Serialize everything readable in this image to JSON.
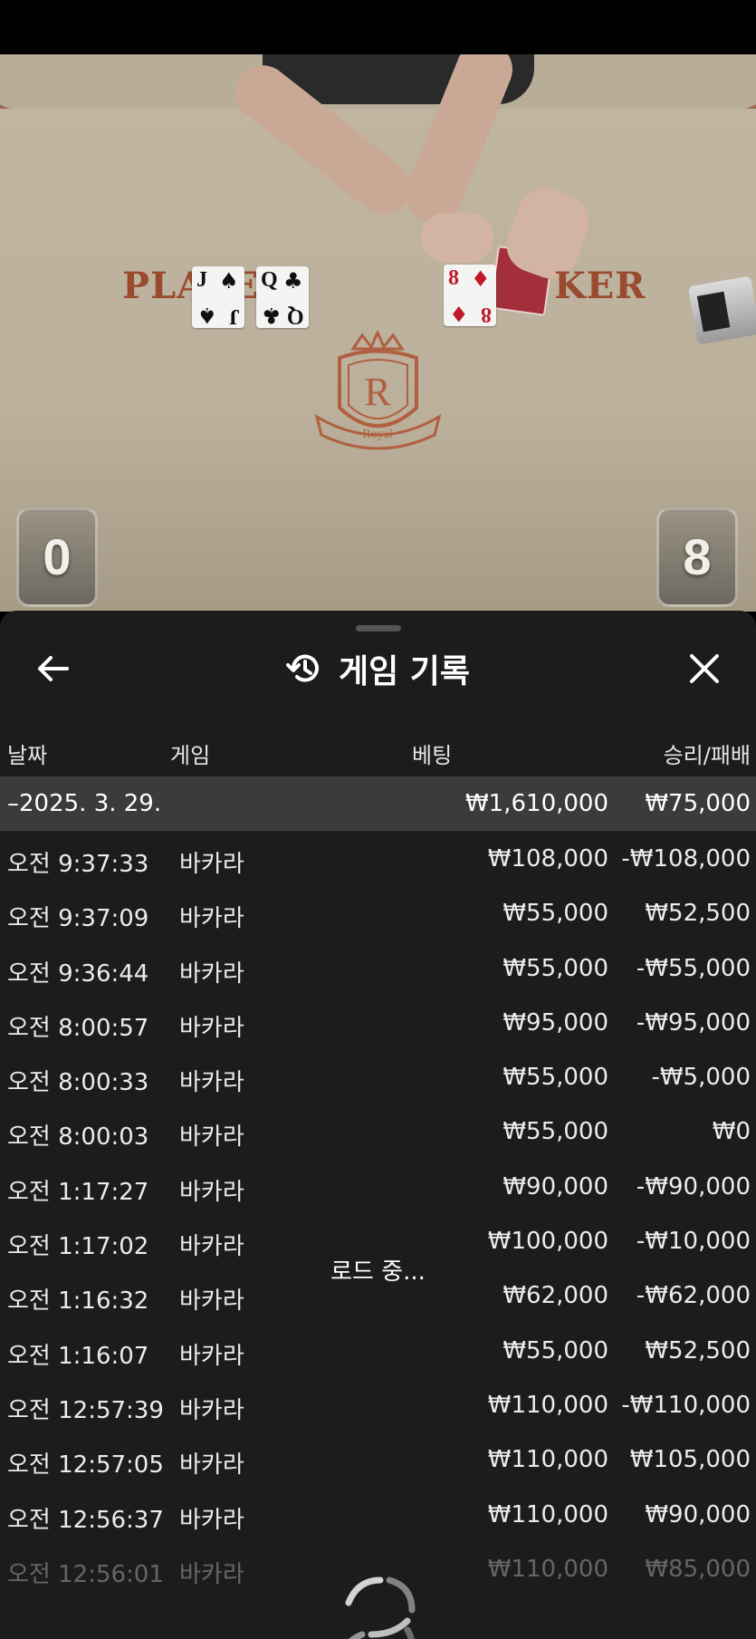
{
  "video": {
    "player_label": "PLAYER",
    "banker_label": "KER",
    "logo_letter": "R",
    "logo_text": "Royal",
    "player_score": "0",
    "banker_score": "8",
    "player_cards": [
      {
        "rank": "J",
        "suit": "♠",
        "color": "black"
      },
      {
        "rank": "Q",
        "suit": "♣",
        "color": "black"
      }
    ],
    "banker_cards": [
      {
        "rank": "8",
        "suit": "♦",
        "color": "red"
      }
    ]
  },
  "panel": {
    "title": "게임 기록",
    "back_icon": "arrow-left-icon",
    "close_icon": "close-icon",
    "title_icon": "history-icon",
    "columns": {
      "date": "날짜",
      "game": "게임",
      "bet": "베팅",
      "result": "승리/패배"
    },
    "date_group": {
      "date": "–2025. 3. 29.",
      "total_bet": "₩1,610,000",
      "total_result": "₩75,000"
    },
    "rows": [
      {
        "time": "오전 9:37:33",
        "game": "바카라",
        "bet": "₩108,000",
        "result": "-₩108,000"
      },
      {
        "time": "오전 9:37:09",
        "game": "바카라",
        "bet": "₩55,000",
        "result": "₩52,500"
      },
      {
        "time": "오전 9:36:44",
        "game": "바카라",
        "bet": "₩55,000",
        "result": "-₩55,000"
      },
      {
        "time": "오전 8:00:57",
        "game": "바카라",
        "bet": "₩95,000",
        "result": "-₩95,000"
      },
      {
        "time": "오전 8:00:33",
        "game": "바카라",
        "bet": "₩55,000",
        "result": "-₩5,000"
      },
      {
        "time": "오전 8:00:03",
        "game": "바카라",
        "bet": "₩55,000",
        "result": "₩0"
      },
      {
        "time": "오전 1:17:27",
        "game": "바카라",
        "bet": "₩90,000",
        "result": "-₩90,000"
      },
      {
        "time": "오전 1:17:02",
        "game": "바카라",
        "bet": "₩100,000",
        "result": "-₩10,000"
      },
      {
        "time": "오전 1:16:32",
        "game": "바카라",
        "bet": "₩62,000",
        "result": "-₩62,000"
      },
      {
        "time": "오전 1:16:07",
        "game": "바카라",
        "bet": "₩55,000",
        "result": "₩52,500"
      },
      {
        "time": "오전 12:57:39",
        "game": "바카라",
        "bet": "₩110,000",
        "result": "-₩110,000"
      },
      {
        "time": "오전 12:57:05",
        "game": "바카라",
        "bet": "₩110,000",
        "result": "₩105,000"
      },
      {
        "time": "오전 12:56:37",
        "game": "바카라",
        "bet": "₩110,000",
        "result": "₩90,000"
      },
      {
        "time": "오전 12:56:01",
        "game": "바카라",
        "bet": "₩110,000",
        "result": "₩85,000"
      }
    ],
    "loading_text": "로드 중..."
  }
}
